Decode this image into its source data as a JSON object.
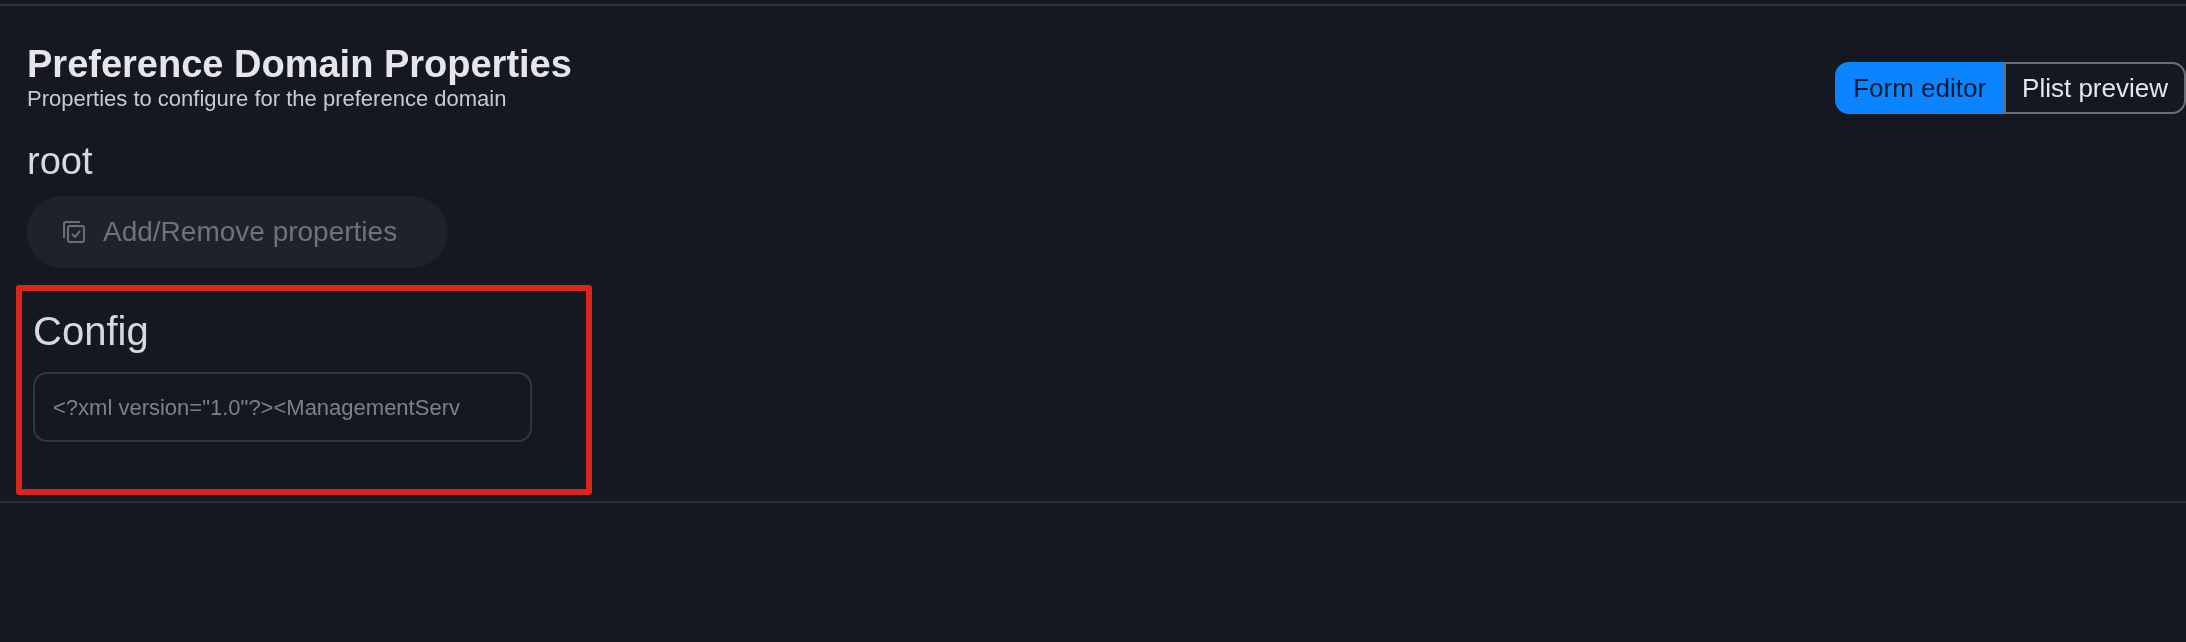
{
  "header": {
    "title": "Preference Domain Properties",
    "subtitle": "Properties to configure for the preference domain"
  },
  "view_toggle": [
    {
      "label": "Form editor",
      "selected": true
    },
    {
      "label": "Plist preview",
      "selected": false
    }
  ],
  "section": {
    "title": "root",
    "button": {
      "label": "Add/Remove properties",
      "disabled": true
    }
  },
  "config": {
    "label": "Config",
    "value": "<?xml version=\"1.0\"?><ManagementServ",
    "highlighted": true
  }
}
